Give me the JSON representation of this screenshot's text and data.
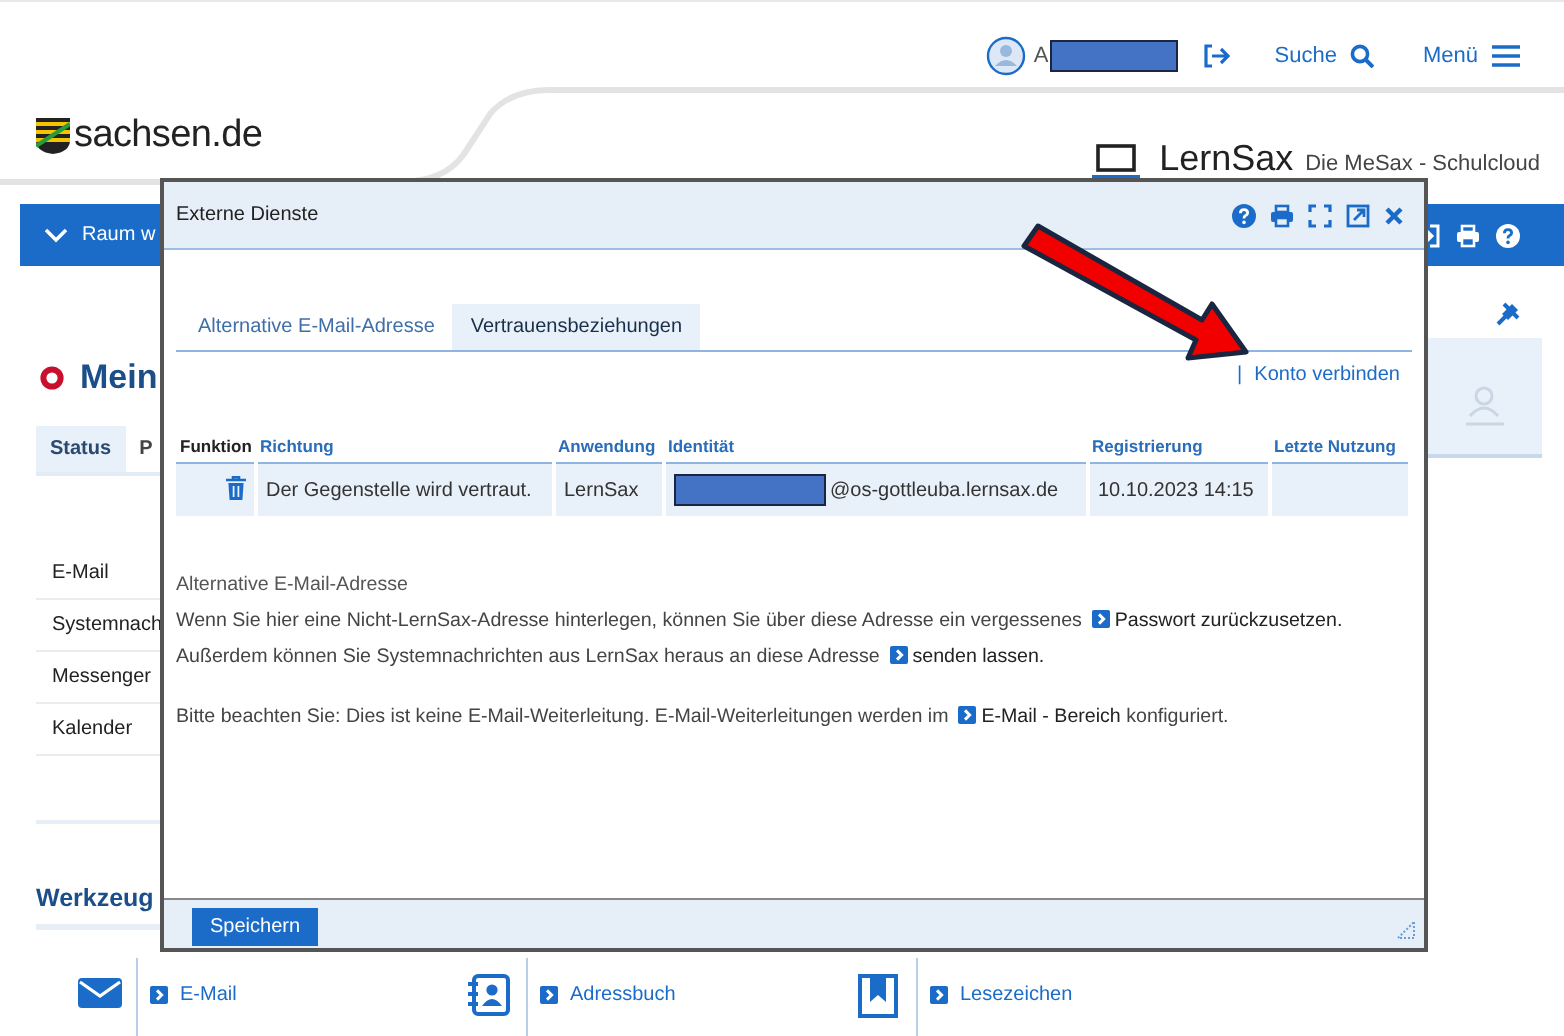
{
  "top_bar": {
    "user_initial": "A",
    "search": "Suche",
    "menu": "Menü"
  },
  "header": {
    "site": "sachsen.de",
    "product": "LernSax",
    "tagline": "Die MeSax - Schulcloud"
  },
  "room_bar": {
    "label": "Raum w"
  },
  "page": {
    "title": "Mein",
    "tabs": [
      {
        "label": "Status",
        "selected": true
      },
      {
        "label": "P",
        "selected": false
      }
    ],
    "nav": [
      "E-Mail",
      "Systemnach",
      "Messenger",
      "Kalender"
    ],
    "tools_heading": "Werkzeug",
    "tools": [
      {
        "label": "E-Mail",
        "kind": "mail"
      },
      {
        "label": "Adressbuch",
        "kind": "contacts"
      },
      {
        "label": "Lesezeichen",
        "kind": "bookmark"
      }
    ]
  },
  "dialog": {
    "title": "Externe Dienste",
    "tabs": [
      {
        "label": "Alternative E-Mail-Adresse",
        "selected": false
      },
      {
        "label": "Vertrauensbeziehungen",
        "selected": true
      }
    ],
    "separator": "|",
    "action": "Konto verbinden",
    "table": {
      "columns": [
        "Funktion",
        "Richtung",
        "Anwendung",
        "Identität",
        "Registrierung",
        "Letzte Nutzung"
      ],
      "rows": [
        {
          "direction": "Der Gegenstelle wird vertraut.",
          "application": "LernSax",
          "identity": "@os-gottleuba.lernsax.de",
          "registered": "10.10.2023 14:15"
        }
      ]
    },
    "info": {
      "heading": "Alternative E-Mail-Adresse",
      "paragraphs": [
        [
          {
            "kind": "text",
            "text": "Wenn Sie hier eine Nicht-LernSax-Adresse hinterlegen, können Sie über diese Adresse ein vergessenes "
          },
          {
            "kind": "link",
            "text": "Passwort zurückzusetzen."
          }
        ],
        [
          {
            "kind": "text",
            "text": "Außerdem können Sie Systemnachrichten aus LernSax heraus an diese Adresse "
          },
          {
            "kind": "link",
            "text": "senden lassen."
          }
        ],
        [
          {
            "kind": "text",
            "text": "Bitte beachten Sie: Dies ist keine E-Mail-Weiterleitung. E-Mail-Weiterleitungen werden im "
          },
          {
            "kind": "link",
            "text": "E-Mail - Bereich"
          },
          {
            "kind": "text",
            "text": " konfiguriert."
          }
        ]
      ]
    },
    "save": "Speichern"
  }
}
